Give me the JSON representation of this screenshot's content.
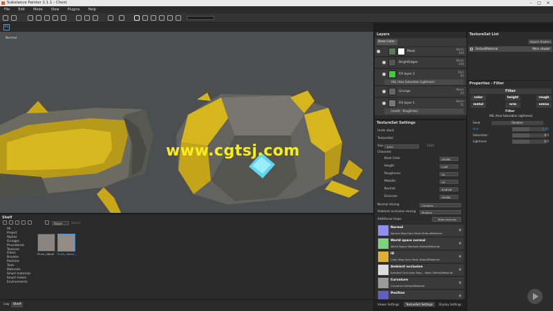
{
  "titlebar": {
    "title": "Substance Painter 2.1.1 - Chest",
    "minimize": "–",
    "maximize": "□",
    "close": "✕"
  },
  "menu": [
    "File",
    "Edit",
    "Mode",
    "View",
    "Plugins",
    "Help"
  ],
  "viewport": {
    "mode_label": "Normal",
    "watermark": "www.cgtsj.com"
  },
  "toolbar2": {
    "ps_label": "Ps"
  },
  "shelf": {
    "title": "Shelf",
    "filter": "Skype",
    "search_placeholder": "Search",
    "categories": [
      "All",
      "Project",
      "Alphas",
      "Grunges",
      "Procedurals",
      "Textures",
      "Filters",
      "Brushes",
      "Particles",
      "Tools",
      "Materials",
      "Smart materials",
      "Smart masks",
      "Environments"
    ],
    "items": [
      {
        "label": "Plush_ribbed"
      },
      {
        "label": "Plush_ribbed_..."
      }
    ]
  },
  "bottom_tabs": [
    "Log",
    "Shelf"
  ],
  "layers": {
    "title": "Layers",
    "blend": "Base Color",
    "rows": [
      {
        "name": "Mask",
        "blend": "Norm",
        "value": "100"
      },
      {
        "name": "BrightEdges",
        "blend": "Norm",
        "value": "100"
      },
      {
        "name": "Fill layer 2",
        "blend": "Ovrl",
        "value": "40",
        "sub": "HSL (Hue Saturation Lightness)"
      },
      {
        "name": "Grunge",
        "blend": "Norm",
        "value": "24"
      },
      {
        "name": "Fill layer 1",
        "blend": "Norm",
        "value": "31",
        "sub": "Levels - Roughness"
      }
    ]
  },
  "textureset_settings": {
    "title": "TextureSet Settings",
    "undo": "Undo stack",
    "set": "TextureSet",
    "size_label": "Size",
    "size_value": "1024",
    "size_value2": "1024",
    "channels_label": "Channels",
    "channels": [
      {
        "name": "Base Color",
        "format": "sRGB8"
      },
      {
        "name": "Height",
        "format": "L16F"
      },
      {
        "name": "Roughness",
        "format": "L8"
      },
      {
        "name": "Metallic",
        "format": "L8"
      },
      {
        "name": "Normal",
        "format": "RGB16F"
      },
      {
        "name": "Emissive",
        "format": "sRGB8"
      }
    ],
    "normal_mixing_label": "Normal mixing",
    "normal_mixing_value": "Combine",
    "ao_mixing_label": "Ambient occlusion mixing",
    "ao_mixing_value": "Multiply",
    "additional_maps": "Additional maps",
    "bake_button": "Bake textures",
    "maps": [
      {
        "title": "Normal",
        "sub": "Normal Map from Mesh DefaultMaterial",
        "color": "#8f8ff0"
      },
      {
        "title": "World space normal",
        "sub": "World Space Normals DefaultMaterial",
        "color": "#7fd07f"
      },
      {
        "title": "ID",
        "sub": "Color Map from Mesh DefaultMaterial",
        "color": "#e0b030"
      },
      {
        "title": "Ambient occlusion",
        "sub": "Ambient Occlusion Map... Mesh DefaultMaterial",
        "color": "#dddddd"
      },
      {
        "title": "Curvature",
        "sub": "Curvature DefaultMaterial",
        "color": "#999999"
      },
      {
        "title": "Position",
        "sub": "",
        "color": "#6060c0"
      }
    ],
    "tabs": [
      "Viewer Settings",
      "TextureSet Settings",
      "Display Settings"
    ]
  },
  "textureset_list": {
    "title": "TextureSet List",
    "import_button": "Import shaders",
    "item": "DefaultMaterial",
    "shader": "Main shader"
  },
  "properties": {
    "title": "Properties - Filter",
    "section": "Filter",
    "channels_row1": [
      "color",
      "height",
      "rough"
    ],
    "channels_row2": [
      "metal",
      "nrm",
      "emiss"
    ],
    "filter_label": "Filter",
    "filter_value": "HSL (Hue Saturation Lightness)",
    "seed_label": "Seed",
    "seed_value": "Random",
    "params": [
      {
        "name": "Hue",
        "value": "0.49",
        "fraction": 0.49
      },
      {
        "name": "Saturation",
        "value": "0.5",
        "fraction": 0.5
      },
      {
        "name": "Lightness",
        "value": "0.5",
        "fraction": 0.5
      }
    ]
  }
}
